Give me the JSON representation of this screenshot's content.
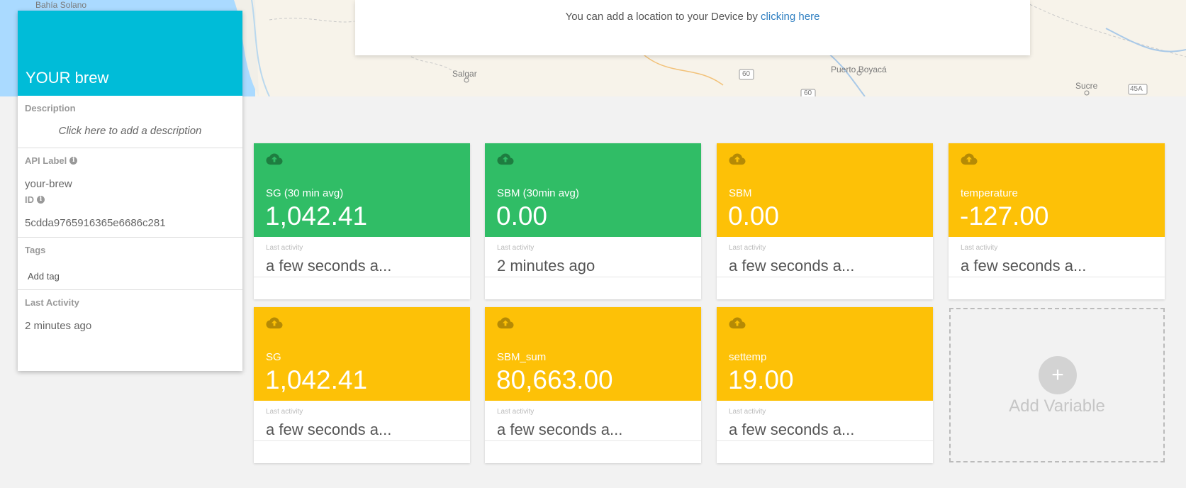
{
  "map": {
    "labels": {
      "bahia_solano": "Bahía Solano",
      "salgar": "Salgar",
      "puerto_boyaca": "Puerto Boyacá",
      "sucre": "Sucre",
      "road_60a": "60",
      "road_60b": "60",
      "road_45a": "45A"
    }
  },
  "location_banner": {
    "text": "You can add a location to your Device by ",
    "link": "clicking here"
  },
  "device": {
    "name": "YOUR brew",
    "description_title": "Description",
    "description_placeholder": "Click here to add a description",
    "api_label_title": "API Label",
    "api_label_value": "your-brew",
    "id_title": "ID",
    "id_value": "5cdda9765916365e6686c281",
    "tags_title": "Tags",
    "add_tag": "Add tag",
    "last_activity_title": "Last Activity",
    "last_activity_value": "2 minutes ago"
  },
  "variables": [
    {
      "label": "SG (30 min avg)",
      "value": "1,042.41",
      "last_activity_label": "Last activity",
      "last_activity": "a few seconds a...",
      "color": "#30bd66",
      "icon": "cloud-upload-icon"
    },
    {
      "label": "SBM (30min avg)",
      "value": "0.00",
      "last_activity_label": "Last activity",
      "last_activity": "2 minutes ago",
      "color": "#30bd66",
      "icon": "cloud-upload-icon"
    },
    {
      "label": "SBM",
      "value": "0.00",
      "last_activity_label": "Last activity",
      "last_activity": "a few seconds a...",
      "color": "#fdc107",
      "icon": "cloud-upload-icon"
    },
    {
      "label": "temperature",
      "value": "-127.00",
      "last_activity_label": "Last activity",
      "last_activity": "a few seconds a...",
      "color": "#fdc107",
      "icon": "cloud-upload-icon"
    },
    {
      "label": "SG",
      "value": "1,042.41",
      "last_activity_label": "Last activity",
      "last_activity": "a few seconds a...",
      "color": "#fdc107",
      "icon": "cloud-upload-icon"
    },
    {
      "label": "SBM_sum",
      "value": "80,663.00",
      "last_activity_label": "Last activity",
      "last_activity": "a few seconds a...",
      "color": "#fdc107",
      "icon": "cloud-upload-icon"
    },
    {
      "label": "settemp",
      "value": "19.00",
      "last_activity_label": "Last activity",
      "last_activity": "a few seconds a...",
      "color": "#fdc107",
      "icon": "cloud-upload-icon"
    }
  ],
  "add_variable": {
    "label": "Add Variable",
    "icon": "plus-icon",
    "symbol": "+"
  }
}
